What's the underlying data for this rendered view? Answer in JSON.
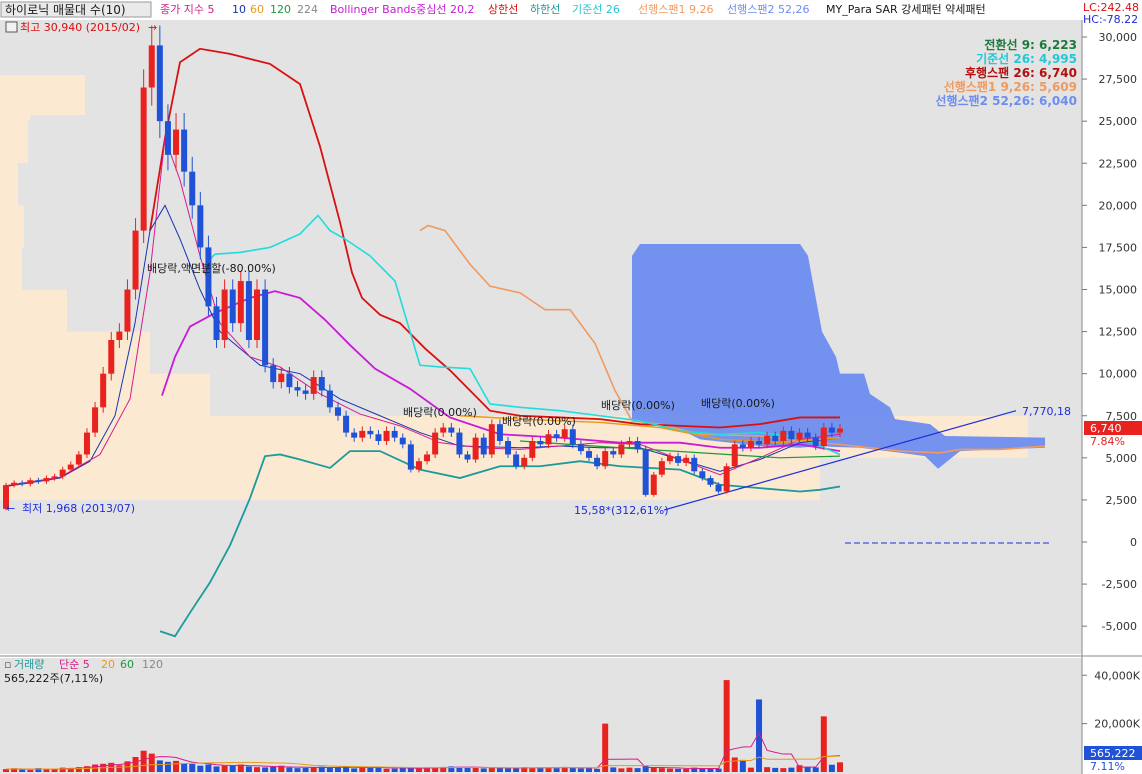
{
  "colors": {
    "bg": "#e3e3e3",
    "up": "#e8231f",
    "down": "#1f52d6",
    "ma5": "#d81b8b",
    "ma10": "#1536b0",
    "ma60": "#e89a1a",
    "ma120": "#1b9a3b",
    "bb_mid": "#c81ad8",
    "bb_up": "#d81010",
    "bb_low": "#1a9a9a",
    "tenkan": "#1a1a1a",
    "kijun": "#20dcdc",
    "chikou": "#b50e0e",
    "span1": "#f09a60",
    "span2": "#6d8def",
    "volume_profile": "#fbe9d2",
    "trendline": "#1f2dd8",
    "neg_line": "#1f2dd8"
  },
  "price_header": [
    {
      "id": "title",
      "text": "하이로닉 매물대 수(10)",
      "color": "#1a1a1a"
    },
    {
      "id": "ma_label",
      "text": "종가 지수 5",
      "color": "#d81b8b"
    },
    {
      "id": "ma10",
      "text": "10",
      "color": "#1536b0"
    },
    {
      "id": "ma60",
      "text": "60",
      "color": "#e89a1a"
    },
    {
      "id": "ma120",
      "text": "120",
      "color": "#1b9a3b"
    },
    {
      "id": "ma224",
      "text": "224",
      "color": "#888888"
    },
    {
      "id": "bb",
      "text": "Bollinger Bands중심선 20,2",
      "color": "#c81ad8"
    },
    {
      "id": "bb_up",
      "text": "상한선",
      "color": "#d81010"
    },
    {
      "id": "bb_low",
      "text": "하한선",
      "color": "#1a9a9a"
    },
    {
      "id": "kijun",
      "text": "기준선 26",
      "color": "#20c8d8"
    },
    {
      "id": "span1",
      "text": "선행스팬1 9,26",
      "color": "#f09a60"
    },
    {
      "id": "span2",
      "text": "선행스팬2 52,26",
      "color": "#6d8def"
    },
    {
      "id": "psar",
      "text": "MY_Para SAR 강세패턴  약세패턴",
      "color": "#1a1a1a"
    }
  ],
  "lc": "LC:242.48",
  "hc": "HC:-78.22",
  "ichimoku_legend": [
    {
      "text": "전환선 9: 6,223",
      "color": "#1b7a3b"
    },
    {
      "text": "기준선 26: 4,995",
      "color": "#20c8d8"
    },
    {
      "text": "후행스팬 26: 6,740",
      "color": "#b50e0e"
    },
    {
      "text": "선행스팬1 9,26: 5,609",
      "color": "#f09a60"
    },
    {
      "text": "선행스팬2 52,26: 6,040",
      "color": "#6d8def"
    }
  ],
  "annotations": {
    "high": "최고 30,940 (2015/02)",
    "low": "최저 1,968 (2013/07)",
    "div_big": "배당락,액면분할(-80.00%)",
    "div1": "배당락(0.00%)",
    "div2": "배당락(0.00%)",
    "div3": "배당락(0.00%)",
    "div4": "배당락(0.00%)",
    "trend_low": "15,58*(312,61%)",
    "trend_high": "7,770,18"
  },
  "price_box": {
    "price": "6,740",
    "pct": "7.84%"
  },
  "volume_header": {
    "items": [
      {
        "text": "거래량",
        "color": "#1b9a9a"
      },
      {
        "text": "단순 5",
        "color": "#d81b8b"
      },
      {
        "text": "20",
        "color": "#e89a1a"
      },
      {
        "text": "60",
        "color": "#1b9a3b"
      },
      {
        "text": "120",
        "color": "#888888"
      }
    ],
    "value": "565,222주(7,11%)"
  },
  "volume_box": {
    "value": "565,222",
    "pct": "7.11%"
  },
  "chart_data": {
    "type": "candlestick",
    "y_ticks": [
      "30,000",
      "27,500",
      "25,000",
      "22,500",
      "20,000",
      "17,500",
      "15,000",
      "12,500",
      "10,000",
      "7,500",
      "5,000",
      "2,500",
      "0",
      "-2,500",
      "-5,000"
    ],
    "y_tick_values": [
      30000,
      27500,
      25000,
      22500,
      20000,
      17500,
      15000,
      12500,
      10000,
      7500,
      5000,
      2500,
      0,
      -2500,
      -5000
    ],
    "ylim": [
      -7000,
      31500
    ],
    "candles": [
      [
        1968,
        3380
      ],
      [
        3380,
        3520
      ],
      [
        3520,
        3450
      ],
      [
        3450,
        3670
      ],
      [
        3670,
        3600
      ],
      [
        3600,
        3800
      ],
      [
        3800,
        3900
      ],
      [
        3900,
        4300
      ],
      [
        4300,
        4600
      ],
      [
        4600,
        5200
      ],
      [
        5200,
        6500
      ],
      [
        6500,
        8000
      ],
      [
        8000,
        10000
      ],
      [
        10000,
        12000
      ],
      [
        12000,
        12500
      ],
      [
        12500,
        15000
      ],
      [
        15000,
        18500
      ],
      [
        18500,
        27000
      ],
      [
        27000,
        29500
      ],
      [
        29500,
        25000
      ],
      [
        25000,
        23000
      ],
      [
        23000,
        24500
      ],
      [
        24500,
        22000
      ],
      [
        22000,
        20000
      ],
      [
        20000,
        17500
      ],
      [
        17500,
        14000
      ],
      [
        14000,
        12000
      ],
      [
        12000,
        15000
      ],
      [
        15000,
        13000
      ],
      [
        13000,
        15500
      ],
      [
        15500,
        12000
      ],
      [
        12000,
        15000
      ],
      [
        15000,
        10500
      ],
      [
        10500,
        9500
      ],
      [
        9500,
        10000
      ],
      [
        10000,
        9200
      ],
      [
        9200,
        9000
      ],
      [
        9000,
        8800
      ],
      [
        8800,
        9800
      ],
      [
        9800,
        9000
      ],
      [
        9000,
        8000
      ],
      [
        8000,
        7500
      ],
      [
        7500,
        6500
      ],
      [
        6500,
        6200
      ],
      [
        6200,
        6600
      ],
      [
        6600,
        6400
      ],
      [
        6400,
        6000
      ],
      [
        6000,
        6600
      ],
      [
        6600,
        6200
      ],
      [
        6200,
        5800
      ],
      [
        5800,
        4300
      ],
      [
        4300,
        4800
      ],
      [
        4800,
        5200
      ],
      [
        5200,
        6500
      ],
      [
        6500,
        6800
      ],
      [
        6800,
        6500
      ],
      [
        6500,
        5200
      ],
      [
        5200,
        4900
      ],
      [
        4900,
        6200
      ],
      [
        6200,
        5200
      ],
      [
        5200,
        7000
      ],
      [
        7000,
        6000
      ],
      [
        6000,
        5200
      ],
      [
        5200,
        4500
      ],
      [
        4500,
        5000
      ],
      [
        5000,
        6000
      ],
      [
        6000,
        5800
      ],
      [
        5800,
        6400
      ],
      [
        6400,
        6200
      ],
      [
        6200,
        6700
      ],
      [
        6700,
        5800
      ],
      [
        5800,
        5400
      ],
      [
        5400,
        5000
      ],
      [
        5000,
        4500
      ],
      [
        4500,
        5400
      ],
      [
        5400,
        5200
      ],
      [
        5200,
        5800
      ],
      [
        5800,
        6000
      ],
      [
        6000,
        5500
      ],
      [
        5500,
        2800
      ],
      [
        2800,
        4000
      ],
      [
        4000,
        4800
      ],
      [
        4800,
        5100
      ],
      [
        5100,
        4700
      ],
      [
        4700,
        5000
      ],
      [
        5000,
        4200
      ],
      [
        4200,
        3800
      ],
      [
        3800,
        3400
      ],
      [
        3400,
        3000
      ],
      [
        3000,
        4500
      ],
      [
        4500,
        5800
      ],
      [
        5800,
        5600
      ],
      [
        5600,
        6000
      ],
      [
        6000,
        5800
      ],
      [
        5800,
        6300
      ],
      [
        6300,
        6000
      ],
      [
        6000,
        6600
      ],
      [
        6600,
        6100
      ],
      [
        6100,
        6500
      ],
      [
        6500,
        6200
      ],
      [
        6200,
        5700
      ],
      [
        5700,
        6800
      ],
      [
        6800,
        6500
      ],
      [
        6500,
        6740
      ]
    ],
    "volume": [
      1200,
      1500,
      1000,
      900,
      1600,
      1100,
      1300,
      1800,
      1600,
      2000,
      2400,
      3100,
      3400,
      3800,
      2800,
      4400,
      6200,
      8800,
      7600,
      4800,
      4200,
      4600,
      3600,
      3300,
      2600,
      3100,
      2300,
      2600,
      2800,
      3100,
      2300,
      2000,
      1900,
      2100,
      2600,
      1800,
      1600,
      1700,
      1900,
      2200,
      1800,
      1900,
      2400,
      1500,
      1700,
      1800,
      2200,
      1300,
      1400,
      1700,
      1600,
      1500,
      1900,
      1800,
      2100,
      2300,
      2100,
      1800,
      1900,
      1500,
      1800,
      1700,
      1600,
      1500,
      2000,
      1800,
      1900,
      1700,
      1600,
      2100,
      1800,
      1500,
      1600,
      1300,
      20000,
      1900,
      1500,
      1800,
      1600,
      2500,
      1800,
      1600,
      1400,
      1300,
      1300,
      1800,
      1500,
      1300,
      1400,
      38000,
      6000,
      5000,
      1800,
      30000,
      2000,
      1700,
      1600,
      1800,
      2800,
      2200,
      1900,
      23000,
      3000,
      4000
    ],
    "vol_y_ticks": [
      "40,000K",
      "20,000K"
    ],
    "vol_y_values": [
      40000,
      20000
    ],
    "vol_ylim": [
      0,
      43000
    ]
  }
}
